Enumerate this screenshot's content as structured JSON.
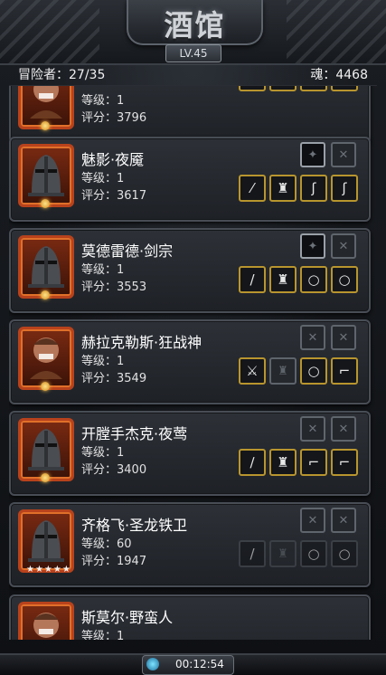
{
  "header": {
    "title": "酒馆",
    "level": "LV.45"
  },
  "status": {
    "adventurers": "冒险者：27/35",
    "soul": "魂：4468"
  },
  "heroes": [
    {
      "name": "",
      "level": "等级：1",
      "score": "评分：3796",
      "avatar": "warrior",
      "skills": [],
      "equip": [
        "sword-icon",
        "armor-icon",
        "boots-icon",
        "boots-icon"
      ]
    },
    {
      "name": "魅影·夜魇",
      "level": "等级：1",
      "score": "评分：3617",
      "avatar": "knight",
      "skills": [
        "on",
        "empty"
      ],
      "equip": [
        "staff-icon",
        "armor-icon",
        "claw-icon",
        "claw-icon"
      ]
    },
    {
      "name": "莫德雷德·剑宗",
      "level": "等级：1",
      "score": "评分：3553",
      "avatar": "knight",
      "skills": [
        "on",
        "empty"
      ],
      "equip": [
        "sword-icon",
        "armor-icon",
        "ring-icon",
        "ring-icon"
      ]
    },
    {
      "name": "赫拉克勒斯·狂战神",
      "level": "等级：1",
      "score": "评分：3549",
      "avatar": "warrior",
      "skills": [
        "empty",
        "empty"
      ],
      "equip": [
        "axe-icon",
        "armor-empty-icon",
        "ring-icon",
        "boots-icon"
      ]
    },
    {
      "name": "开膛手杰克·夜莺",
      "level": "等级：1",
      "score": "评分：3400",
      "avatar": "knight",
      "skills": [
        "empty",
        "empty"
      ],
      "equip": [
        "dagger-icon",
        "armor-icon",
        "boots-icon",
        "boots-icon"
      ]
    },
    {
      "name": "齐格飞·圣龙铁卫",
      "level": "等级：60",
      "score": "评分：1947",
      "avatar": "knight",
      "stars": "★★★★★",
      "skills": [
        "empty",
        "empty"
      ],
      "equip": [
        "sword-icon",
        "armor-empty-icon",
        "ring-icon",
        "ring-icon"
      ]
    },
    {
      "name": "斯莫尔·野蛮人",
      "level": "等级：1",
      "score": "",
      "avatar": "warrior",
      "skills": [],
      "equip": []
    }
  ],
  "footer": {
    "timer": "00:12:54"
  }
}
